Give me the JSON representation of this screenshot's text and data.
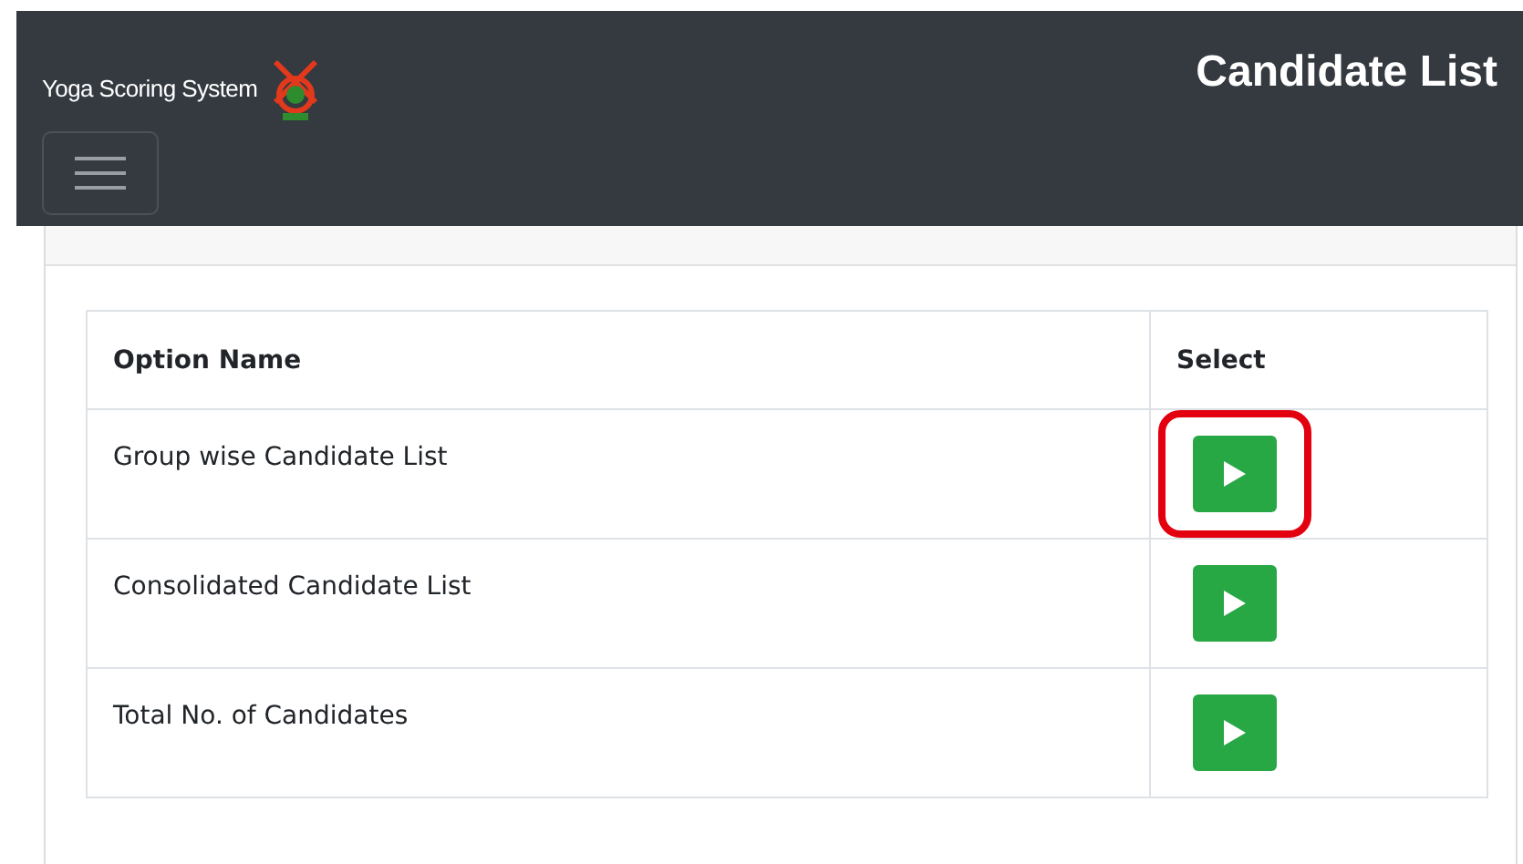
{
  "header": {
    "brand": "Yoga Scoring System",
    "page_title": "Candidate List"
  },
  "table": {
    "columns": [
      "Option Name",
      "Select"
    ],
    "rows": [
      {
        "option": "Group wise Candidate List",
        "highlighted": true
      },
      {
        "option": "Consolidated Candidate List",
        "highlighted": false
      },
      {
        "option": "Total No. of Candidates",
        "highlighted": false
      }
    ]
  }
}
